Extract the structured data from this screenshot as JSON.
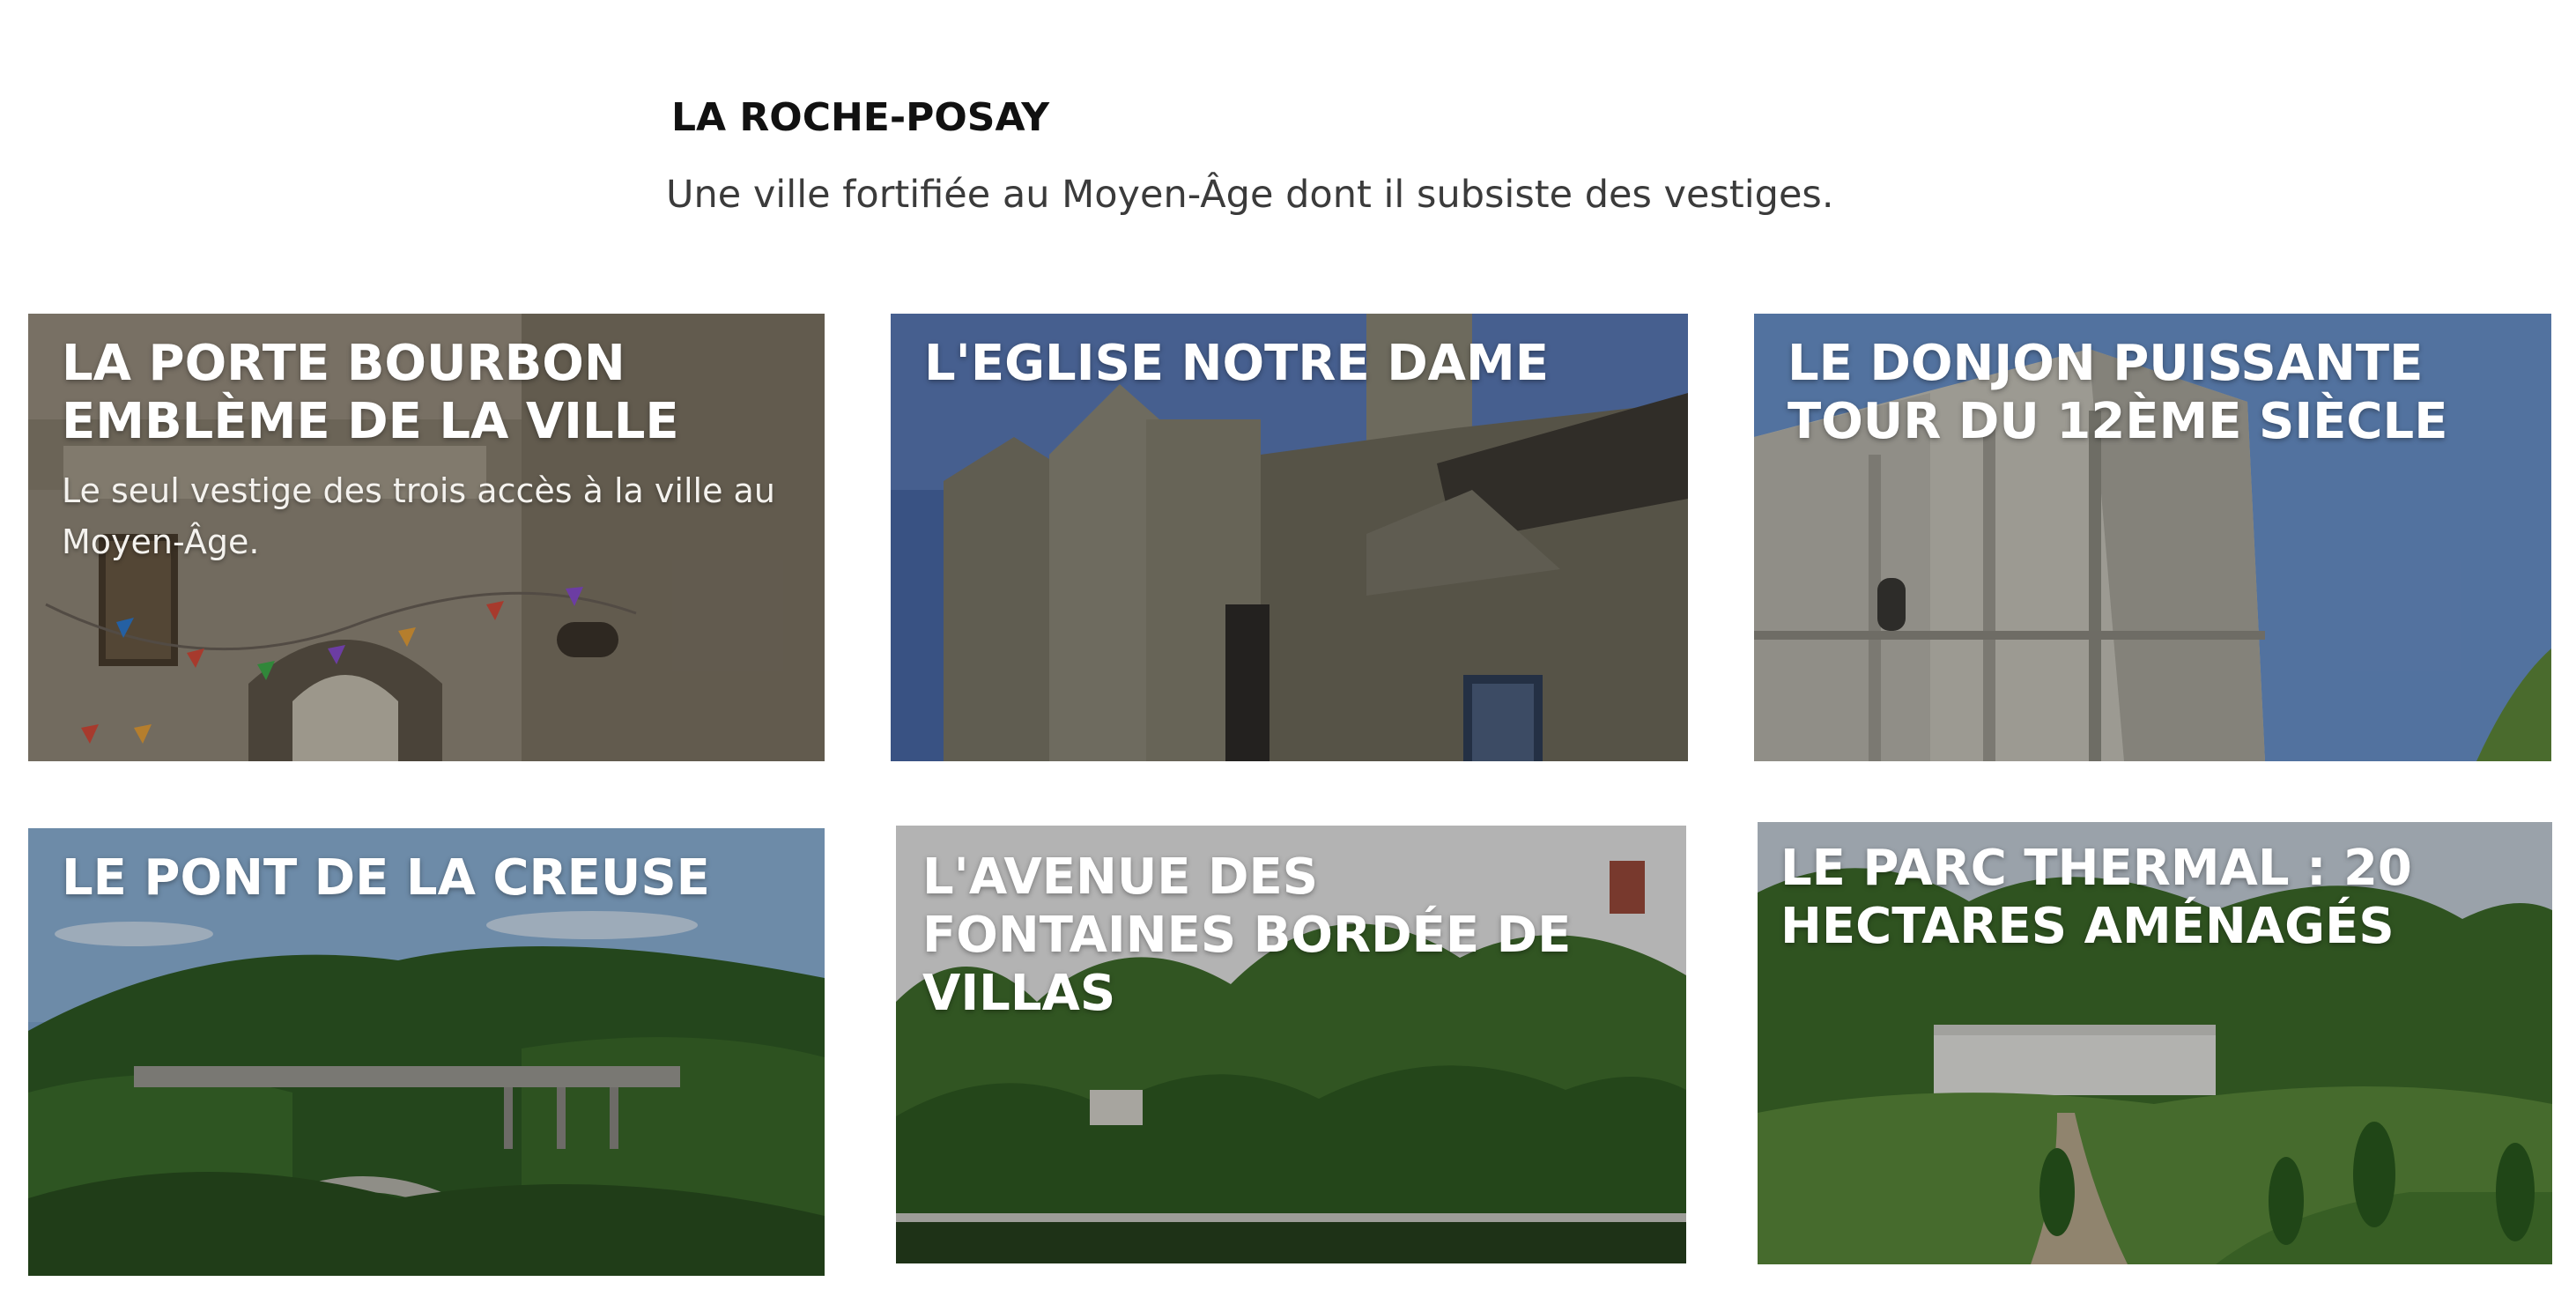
{
  "header": {
    "title": "LA ROCHE-POSAY",
    "subtitle": "Une ville fortifiée au Moyen-Âge dont il subsiste des vestiges."
  },
  "cards": [
    {
      "title": "LA PORTE BOURBON\nEMBLÈME DE LA VILLE",
      "description": "Le seul vestige des trois accès à la ville au Moyen-Âge."
    },
    {
      "title": "L'EGLISE NOTRE DAME",
      "description": ""
    },
    {
      "title": "LE DONJON PUISSANTE\nTOUR DU 12ÈME SIÈCLE",
      "description": ""
    },
    {
      "title": "LE PONT DE LA CREUSE",
      "description": ""
    },
    {
      "title": "L'AVENUE DES\nFONTAINES BORDÉE DE\nVILLAS",
      "description": ""
    },
    {
      "title": "LE PARC THERMAL : 20\nHECTARES AMÉNAGÉS",
      "description": ""
    }
  ],
  "colors": {
    "background": "#ffffff",
    "title_text": "#111111",
    "subtitle_text": "#3b3b3b",
    "card_text": "#ffffff"
  }
}
